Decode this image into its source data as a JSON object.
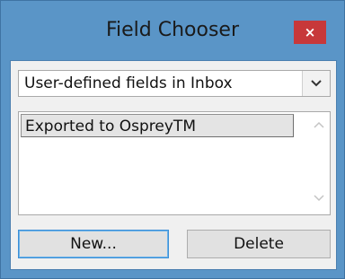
{
  "window": {
    "title": "Field Chooser",
    "close_label": "×",
    "colors": {
      "frame": "#5a95c7",
      "close_button": "#c7383a",
      "client": "#f0f0f0"
    }
  },
  "dropdown": {
    "selected": "User-defined fields in Inbox",
    "arrow_icon": "chevron-down-icon"
  },
  "field_list": {
    "items": [
      {
        "label": "Exported to OspreyTM"
      }
    ]
  },
  "buttons": {
    "new_label": "New...",
    "delete_label": "Delete"
  }
}
